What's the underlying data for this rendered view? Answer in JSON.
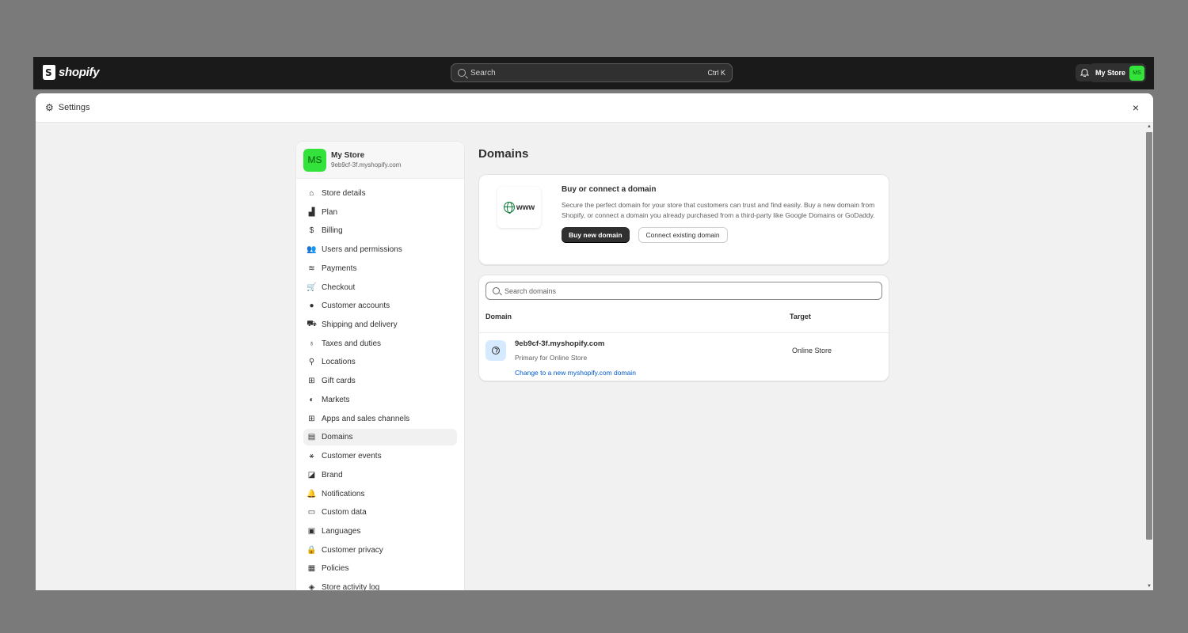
{
  "topbar": {
    "logo": "shopify",
    "search_placeholder": "Search",
    "search_shortcut": "Ctrl K",
    "store_button": "My Store",
    "store_initials": "MS"
  },
  "window": {
    "title": "Settings",
    "close": "×"
  },
  "sidebar": {
    "store_name": "My Store",
    "store_initials": "MS",
    "store_url": "9eb9cf-3f.myshopify.com",
    "items": [
      {
        "label": "Store details",
        "icon": "store-icon",
        "glyph": "⌂"
      },
      {
        "label": "Plan",
        "icon": "plan-icon",
        "glyph": "▟"
      },
      {
        "label": "Billing",
        "icon": "billing-icon",
        "glyph": "$"
      },
      {
        "label": "Users and permissions",
        "icon": "users-icon",
        "glyph": "👥"
      },
      {
        "label": "Payments",
        "icon": "payments-icon",
        "glyph": "≋"
      },
      {
        "label": "Checkout",
        "icon": "cart-icon",
        "glyph": "🛒"
      },
      {
        "label": "Customer accounts",
        "icon": "person-icon",
        "glyph": "●"
      },
      {
        "label": "Shipping and delivery",
        "icon": "truck-icon",
        "glyph": "⛟"
      },
      {
        "label": "Taxes and duties",
        "icon": "tax-icon",
        "glyph": "♁"
      },
      {
        "label": "Locations",
        "icon": "location-icon",
        "glyph": "⚲"
      },
      {
        "label": "Gift cards",
        "icon": "gift-icon",
        "glyph": "⊞"
      },
      {
        "label": "Markets",
        "icon": "globe-icon",
        "glyph": "◐"
      },
      {
        "label": "Apps and sales channels",
        "icon": "apps-icon",
        "glyph": "⊞"
      },
      {
        "label": "Domains",
        "icon": "domains-icon",
        "glyph": "▤"
      },
      {
        "label": "Customer events",
        "icon": "cursor-icon",
        "glyph": "⚹"
      },
      {
        "label": "Brand",
        "icon": "brand-icon",
        "glyph": "◪"
      },
      {
        "label": "Notifications",
        "icon": "bell-icon",
        "glyph": "🔔"
      },
      {
        "label": "Custom data",
        "icon": "data-icon",
        "glyph": "▭"
      },
      {
        "label": "Languages",
        "icon": "language-icon",
        "glyph": "▣"
      },
      {
        "label": "Customer privacy",
        "icon": "lock-icon",
        "glyph": "🔒"
      },
      {
        "label": "Policies",
        "icon": "policies-icon",
        "glyph": "▦"
      },
      {
        "label": "Store activity log",
        "icon": "activity-icon",
        "glyph": "◈"
      }
    ],
    "active_index": 13
  },
  "main": {
    "title": "Domains",
    "promo": {
      "image_text": "www",
      "heading": "Buy or connect a domain",
      "body": "Secure the perfect domain for your store that customers can trust and find easily. Buy a new domain from Shopify, or connect a domain you already purchased from a third-party like Google Domains or GoDaddy.",
      "primary_button": "Buy new domain",
      "secondary_button": "Connect existing domain"
    },
    "domains": {
      "search_placeholder": "Search domains",
      "col_domain": "Domain",
      "col_target": "Target",
      "rows": [
        {
          "name": "9eb9cf-3f.myshopify.com",
          "sub": "Primary for Online Store",
          "link": "Change to a new myshopify.com domain",
          "target": "Online Store"
        }
      ]
    }
  },
  "colors": {
    "topbar": "#1a1a1a",
    "avatar": "#33e23a",
    "link": "#005bd3",
    "primary_button": "#303030"
  }
}
